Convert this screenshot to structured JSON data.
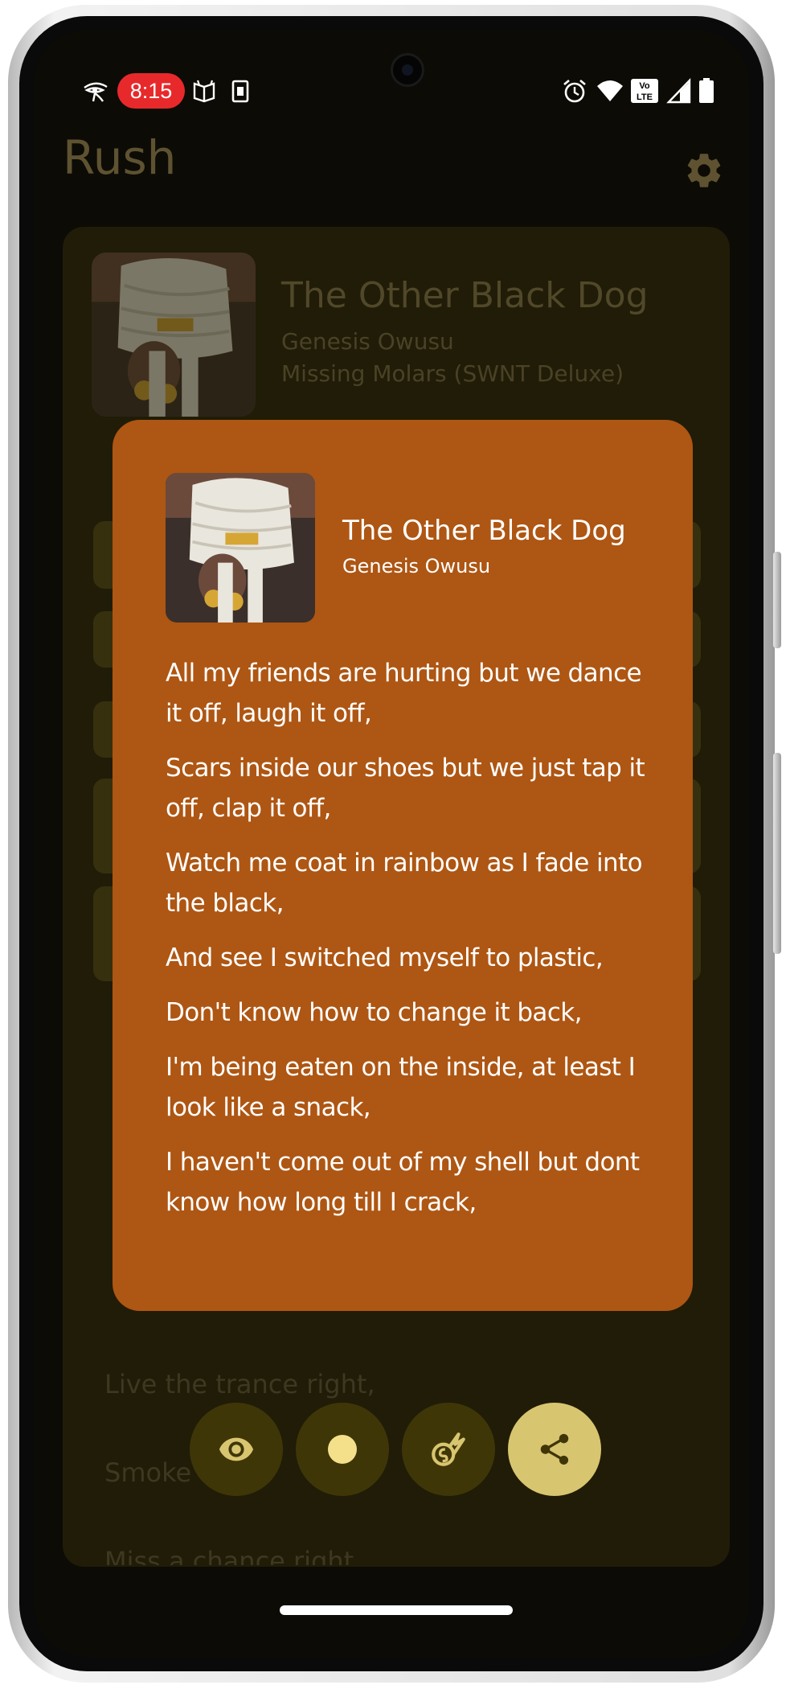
{
  "status_bar": {
    "time": "8:15",
    "left_icons": [
      "eye-of-horus-icon",
      "time-pill",
      "book-icon",
      "sim-icon"
    ],
    "right_icons": [
      "alarm-icon",
      "wifi-icon",
      "volte-icon",
      "signal-icon",
      "battery-icon"
    ],
    "volte_text": "Vo LTE"
  },
  "app": {
    "title": "Rush",
    "settings_icon": "gear-icon"
  },
  "now_playing": {
    "title": "The Other Black Dog",
    "artist": "Genesis Owusu",
    "album": "Missing Molars (SWNT Deluxe)"
  },
  "background_lyrics": [
    "Live the trance right,",
    "Smoke",
    "Miss a chance right"
  ],
  "share_card": {
    "title": "The Other Black Dog",
    "artist": "Genesis Owusu",
    "lyrics": [
      "All my friends are hurting but we dance it off, laugh it off,",
      "Scars inside our shoes but we just tap it off, clap it off,",
      "Watch me coat in rainbow as I fade into the black,",
      "And see I switched myself to plastic,",
      "Don't know how to change it back,",
      "I'm being eaten on the inside, at least I look like a snack,",
      "I haven't come out of my shell but dont know how long till I crack,"
    ],
    "background_color": "#ae5613"
  },
  "actions": [
    {
      "name": "eye-button",
      "icon": "eye-icon",
      "active": false
    },
    {
      "name": "color-button",
      "icon": "dot-icon",
      "active": false
    },
    {
      "name": "meteor-button",
      "icon": "meteor-icon",
      "active": false
    },
    {
      "name": "share-button",
      "icon": "share-icon",
      "active": true
    }
  ],
  "colors": {
    "accent": "#d8c56f",
    "fab_inactive": "#3f3608",
    "app_title": "#5e5231",
    "screen_bg": "#0c0b05"
  }
}
